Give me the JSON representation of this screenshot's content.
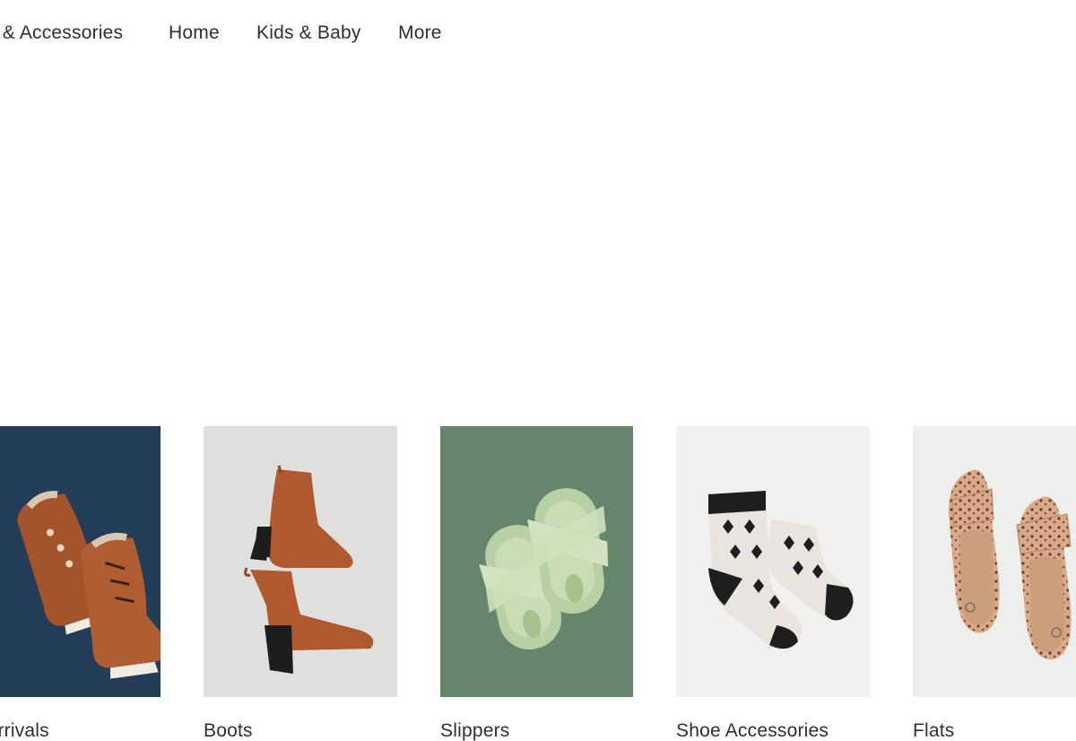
{
  "nav": {
    "items": [
      {
        "label": "y & Accessories"
      },
      {
        "label": "Home"
      },
      {
        "label": "Kids & Baby"
      },
      {
        "label": "More"
      }
    ]
  },
  "categories": [
    {
      "label": "w Arrivals",
      "image": "brown-lace-up-winter-boots-on-navy",
      "bg": "#213a52"
    },
    {
      "label": "Boots",
      "image": "cognac-ankle-boots-on-grey",
      "bg": "#e3e3e1"
    },
    {
      "label": "Slippers",
      "image": "sage-fuzzy-slippers-on-green",
      "bg": "#6b8a72"
    },
    {
      "label": "Shoe Accessories",
      "image": "fair-isle-socks-on-white",
      "bg": "#f2f1ef"
    },
    {
      "label": "Flats",
      "image": "leopard-print-flats-on-white",
      "bg": "#eeeeec"
    }
  ]
}
